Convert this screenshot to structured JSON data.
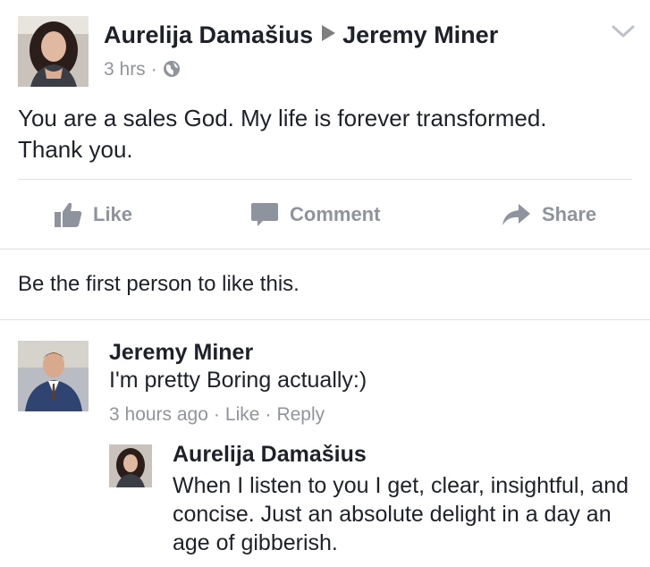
{
  "post": {
    "author": "Aurelija Damašius",
    "target": "Jeremy Miner",
    "time": "3 hrs",
    "meta_separator": "·",
    "privacy_icon": "globe-icon",
    "body_line1": "You are a sales God. My life is forever transformed.",
    "body_line2": "Thank you."
  },
  "actions": {
    "like": "Like",
    "comment": "Comment",
    "share": "Share"
  },
  "likes_text": "Be the first person to like this.",
  "comments": [
    {
      "name": "Jeremy Miner",
      "text": "I'm pretty Boring actually:)",
      "time": "3 hours ago",
      "separator": "·",
      "like_label": "Like",
      "reply_label": "Reply"
    },
    {
      "name": "Aurelija Damašius",
      "text": "When I listen to you I get, clear, insightful, and concise. Just an absolute delight in a day an age of gibberish."
    }
  ],
  "colors": {
    "text": "#1d2129",
    "secondary": "#90949c",
    "action": "#8d949e",
    "divider": "#dddfe2"
  }
}
